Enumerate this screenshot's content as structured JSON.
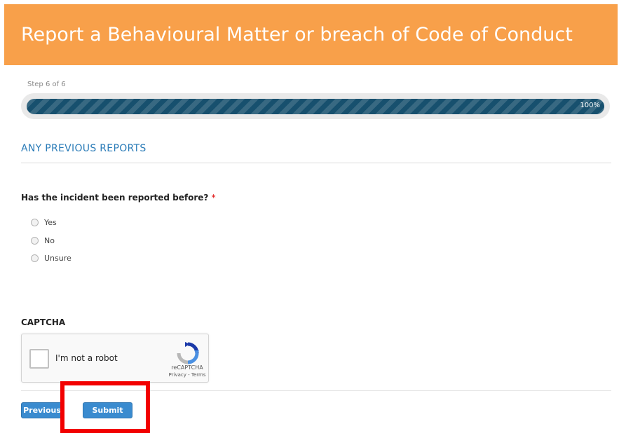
{
  "header": {
    "title": "Report a Behavioural Matter or breach of Code of Conduct",
    "bg_color": "#f8a04a"
  },
  "progress": {
    "step_text": "Step 6 of 6",
    "percent": 100,
    "label": "100%"
  },
  "section": {
    "title": "ANY PREVIOUS REPORTS"
  },
  "question": {
    "label": "Has the incident been reported before?",
    "required_marker": "*",
    "options": [
      "Yes",
      "No",
      "Unsure"
    ]
  },
  "captcha": {
    "label": "CAPTCHA",
    "checkbox_text": "I'm not a robot",
    "brand": "reCAPTCHA",
    "links": "Privacy - Terms"
  },
  "buttons": {
    "previous": "Previous",
    "submit": "Submit"
  },
  "colors": {
    "accent": "#3a8bcf",
    "progress": "#17506e",
    "highlight": "#f20000"
  }
}
